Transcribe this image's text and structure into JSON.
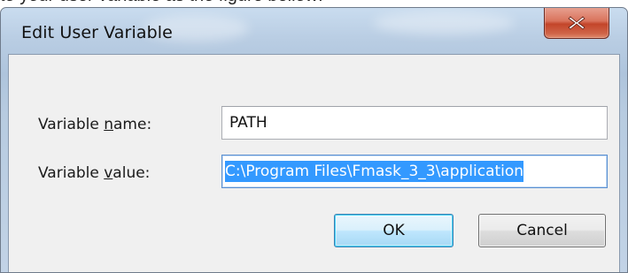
{
  "window": {
    "title": "Edit User Variable",
    "close_icon": "close-x-icon"
  },
  "fields": {
    "name_label_prefix": "Variable ",
    "name_label_accel": "n",
    "name_label_suffix": "ame:",
    "name_value": "PATH",
    "value_label_prefix": "Variable ",
    "value_label_accel": "v",
    "value_label_suffix": "alue:",
    "value_value": "C:\\Program Files\\Fmask_3_3\\application"
  },
  "buttons": {
    "ok_label": "OK",
    "cancel_label": "Cancel"
  },
  "colors": {
    "selection": "#3399ff",
    "close_button": "#c3452a",
    "frame": "#b9cde3"
  }
}
